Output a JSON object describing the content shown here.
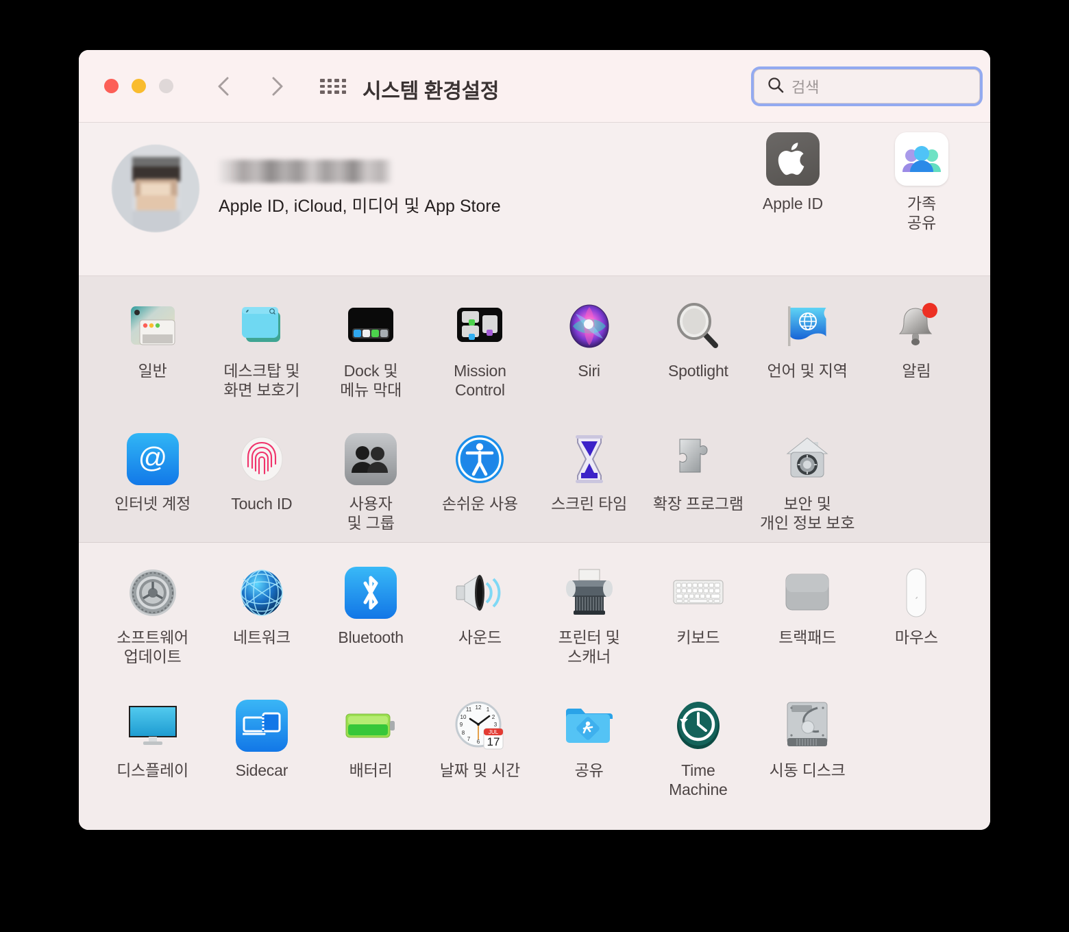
{
  "window": {
    "title": "시스템 환경설정",
    "traffic_lights": {
      "close": "close-red",
      "minimize": "minimize-yellow",
      "zoom": "zoom-gray-disabled"
    },
    "nav": {
      "back": "back-chevron",
      "forward": "forward-chevron"
    },
    "grid_button": "show-all-grid"
  },
  "search": {
    "placeholder": "검색",
    "value": "",
    "icon": "search-icon",
    "focused": true,
    "focus_ring_color": "#93AAF0"
  },
  "account": {
    "name_redacted": true,
    "subtitle": "Apple ID, iCloud, 미디어 및 App Store",
    "avatar": "user-avatar-blurred",
    "tiles": [
      {
        "label": "Apple ID",
        "icon": "apple-logo-icon"
      },
      {
        "label": "가족\n공유",
        "icon": "family-sharing-icon"
      }
    ]
  },
  "sections": [
    {
      "id": "personal",
      "items": [
        {
          "label": "일반",
          "icon": "general-window-icon"
        },
        {
          "label": "데스크탑 및\n화면 보호기",
          "icon": "desktop-screensaver-icon"
        },
        {
          "label": "Dock 및\n메뉴 막대",
          "icon": "dock-menubar-icon"
        },
        {
          "label": "Mission\nControl",
          "icon": "mission-control-icon"
        },
        {
          "label": "Siri",
          "icon": "siri-icon"
        },
        {
          "label": "Spotlight",
          "icon": "spotlight-icon"
        },
        {
          "label": "언어 및 지역",
          "icon": "language-region-flag-icon"
        },
        {
          "label": "알림",
          "icon": "notifications-bell-icon"
        },
        {
          "label": "인터넷 계정",
          "icon": "internet-accounts-at-icon"
        },
        {
          "label": "Touch ID",
          "icon": "touch-id-fingerprint-icon"
        },
        {
          "label": "사용자\n및 그룹",
          "icon": "users-groups-icon"
        },
        {
          "label": "손쉬운 사용",
          "icon": "accessibility-icon"
        },
        {
          "label": "스크린 타임",
          "icon": "screen-time-hourglass-icon"
        },
        {
          "label": "확장 프로그램",
          "icon": "extensions-puzzle-icon"
        },
        {
          "label": "보안 및\n개인 정보 보호",
          "icon": "security-privacy-house-icon"
        }
      ]
    },
    {
      "id": "hardware",
      "items": [
        {
          "label": "소프트웨어\n업데이트",
          "icon": "software-update-gear-icon"
        },
        {
          "label": "네트워크",
          "icon": "network-globe-icon"
        },
        {
          "label": "Bluetooth",
          "icon": "bluetooth-icon"
        },
        {
          "label": "사운드",
          "icon": "sound-speaker-icon"
        },
        {
          "label": "프린터 및\n스캐너",
          "icon": "printer-scanner-icon"
        },
        {
          "label": "키보드",
          "icon": "keyboard-icon"
        },
        {
          "label": "트랙패드",
          "icon": "trackpad-icon"
        },
        {
          "label": "마우스",
          "icon": "mouse-icon"
        },
        {
          "label": "디스플레이",
          "icon": "display-monitor-icon"
        },
        {
          "label": "Sidecar",
          "icon": "sidecar-icon"
        },
        {
          "label": "배터리",
          "icon": "battery-icon"
        },
        {
          "label": "날짜 및 시간",
          "icon": "date-time-clock-icon"
        },
        {
          "label": "공유",
          "icon": "sharing-folder-icon"
        },
        {
          "label": "Time\nMachine",
          "icon": "time-machine-icon"
        },
        {
          "label": "시동 디스크",
          "icon": "startup-disk-icon"
        }
      ]
    }
  ],
  "annotation": {
    "type": "arrow",
    "color": "#F4275F",
    "points_to": "손쉬운 사용"
  }
}
